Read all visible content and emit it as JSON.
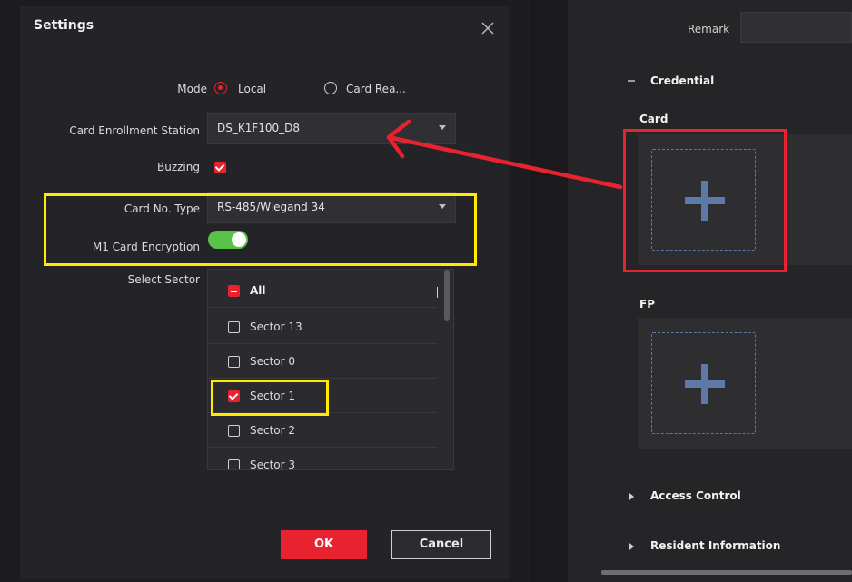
{
  "dialog": {
    "title": "Settings",
    "mode_label": "Mode",
    "mode_options": [
      "Local",
      "Card Rea..."
    ],
    "enrollment_label": "Card Enrollment Station",
    "enrollment_value": "DS_K1F100_D8",
    "buzzing_label": "Buzzing",
    "card_type_label": "Card No. Type",
    "card_type_value": "RS-485/Wiegand 34",
    "m1_label": "M1 Card Encryption",
    "sector_label": "Select Sector",
    "sectors": {
      "all": "All",
      "items": [
        "Sector 13",
        "Sector 0",
        "Sector 1",
        "Sector 2",
        "Sector 3"
      ]
    },
    "ok_label": "OK",
    "cancel_label": "Cancel"
  },
  "panel": {
    "remark_label": "Remark",
    "credential_label": "Credential",
    "card_label": "Card",
    "fp_label": "FP",
    "access_label": "Access Control",
    "resident_label": "Resident Information"
  },
  "colors": {
    "accent_red": "#e8222e",
    "toggle_green": "#5ac149",
    "highlight_yellow": "#ffeb00",
    "add_blue": "#5b7aa8"
  }
}
